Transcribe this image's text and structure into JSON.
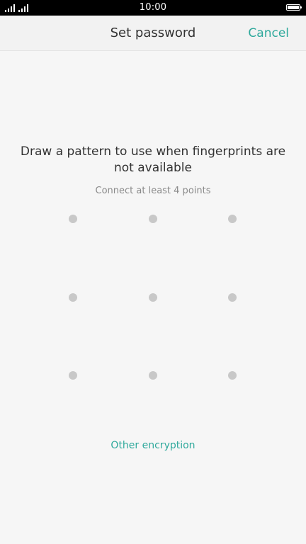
{
  "status_bar": {
    "time": "10:00"
  },
  "header": {
    "title": "Set password",
    "cancel_label": "Cancel"
  },
  "main": {
    "instruction": "Draw a pattern to use when fingerprints are not available",
    "hint": "Connect at least 4 points",
    "pattern": {
      "rows": 3,
      "cols": 3,
      "selected_points": 0
    },
    "other_encryption_label": "Other encryption"
  },
  "colors": {
    "accent": "#2fa99c",
    "dot": "#c8c8c8",
    "background": "#f6f6f6"
  },
  "icons": {
    "signal": "signal-strength-icon",
    "battery": "battery-icon"
  }
}
